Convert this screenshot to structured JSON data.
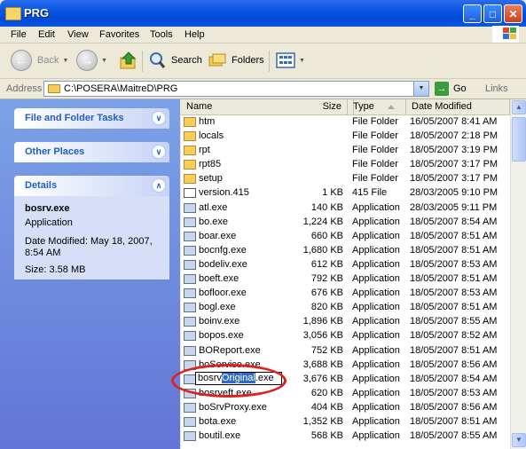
{
  "window": {
    "title": "PRG"
  },
  "title_buttons": {
    "minimize": "_",
    "maximize": "□",
    "close": "✕"
  },
  "menu": [
    "File",
    "Edit",
    "View",
    "Favorites",
    "Tools",
    "Help"
  ],
  "toolbar": {
    "back": "Back",
    "search": "Search",
    "folders": "Folders"
  },
  "address": {
    "label": "Address",
    "path": "C:\\POSERA\\MaitreD\\PRG",
    "go": "Go",
    "links": "Links"
  },
  "taskpane": {
    "panels": [
      {
        "title": "File and Folder Tasks",
        "state": "collapsed"
      },
      {
        "title": "Other Places",
        "state": "collapsed"
      },
      {
        "title": "Details",
        "state": "expanded"
      }
    ],
    "details": {
      "name": "bosrv.exe",
      "type": "Application",
      "modified_line1": "Date Modified: May 18, 2007,",
      "modified_line2": "8:54 AM",
      "size": "Size: 3.58 MB"
    }
  },
  "columns": {
    "name": "Name",
    "size": "Size",
    "type": "Type",
    "modified": "Date Modified"
  },
  "files": [
    {
      "name": "htm",
      "size": "",
      "type": "File Folder",
      "date": "16/05/2007 8:41 AM",
      "icon": "folder-icon"
    },
    {
      "name": "locals",
      "size": "",
      "type": "File Folder",
      "date": "18/05/2007 2:18 PM",
      "icon": "folder-icon"
    },
    {
      "name": "rpt",
      "size": "",
      "type": "File Folder",
      "date": "18/05/2007 3:19 PM",
      "icon": "folder-icon"
    },
    {
      "name": "rpt85",
      "size": "",
      "type": "File Folder",
      "date": "18/05/2007 3:17 PM",
      "icon": "folder-icon"
    },
    {
      "name": "setup",
      "size": "",
      "type": "File Folder",
      "date": "18/05/2007 3:17 PM",
      "icon": "folder-icon"
    },
    {
      "name": "version.415",
      "size": "1 KB",
      "type": "415 File",
      "date": "28/03/2005 9:10 PM",
      "icon": "file-icon"
    },
    {
      "name": "atl.exe",
      "size": "140 KB",
      "type": "Application",
      "date": "28/03/2005 9:11 PM",
      "icon": "exe-icon"
    },
    {
      "name": "bo.exe",
      "size": "1,224 KB",
      "type": "Application",
      "date": "18/05/2007 8:54 AM",
      "icon": "exe-icon"
    },
    {
      "name": "boar.exe",
      "size": "660 KB",
      "type": "Application",
      "date": "18/05/2007 8:51 AM",
      "icon": "exe-icon"
    },
    {
      "name": "bocnfg.exe",
      "size": "1,680 KB",
      "type": "Application",
      "date": "18/05/2007 8:51 AM",
      "icon": "exe-icon"
    },
    {
      "name": "bodeliv.exe",
      "size": "612 KB",
      "type": "Application",
      "date": "18/05/2007 8:53 AM",
      "icon": "exe-icon"
    },
    {
      "name": "boeft.exe",
      "size": "792 KB",
      "type": "Application",
      "date": "18/05/2007 8:51 AM",
      "icon": "exe-icon"
    },
    {
      "name": "bofloor.exe",
      "size": "676 KB",
      "type": "Application",
      "date": "18/05/2007 8:53 AM",
      "icon": "exe-icon"
    },
    {
      "name": "bogl.exe",
      "size": "820 KB",
      "type": "Application",
      "date": "18/05/2007 8:51 AM",
      "icon": "exe-icon"
    },
    {
      "name": "boinv.exe",
      "size": "1,896 KB",
      "type": "Application",
      "date": "18/05/2007 8:55 AM",
      "icon": "exe-icon"
    },
    {
      "name": "bopos.exe",
      "size": "3,056 KB",
      "type": "Application",
      "date": "18/05/2007 8:52 AM",
      "icon": "exe-icon"
    },
    {
      "name": "BOReport.exe",
      "size": "752 KB",
      "type": "Application",
      "date": "18/05/2007 8:51 AM",
      "icon": "exe-icon"
    },
    {
      "name": "boService.exe",
      "size": "3,688 KB",
      "type": "Application",
      "date": "18/05/2007 8:56 AM",
      "icon": "exe-icon"
    },
    {
      "name": "",
      "size": "3,676 KB",
      "type": "Application",
      "date": "18/05/2007 8:54 AM",
      "icon": "exe-icon",
      "rename": true
    },
    {
      "name": "bosrveft.exe",
      "size": "620 KB",
      "type": "Application",
      "date": "18/05/2007 8:53 AM",
      "icon": "exe-icon"
    },
    {
      "name": "boSrvProxy.exe",
      "size": "404 KB",
      "type": "Application",
      "date": "18/05/2007 8:56 AM",
      "icon": "exe-icon"
    },
    {
      "name": "bota.exe",
      "size": "1,352 KB",
      "type": "Application",
      "date": "18/05/2007 8:51 AM",
      "icon": "exe-icon"
    },
    {
      "name": "boutil.exe",
      "size": "568 KB",
      "type": "Application",
      "date": "18/05/2007 8:55 AM",
      "icon": "exe-icon"
    }
  ],
  "rename": {
    "before": "bosrv",
    "selected": "Original",
    "after": ".exe"
  },
  "colors": {
    "titlebar": "#0a55e0",
    "taskpane": "#6f8be0",
    "panel_title": "#215dc6",
    "highlight_oval": "#e0201b",
    "selection": "#316ac5"
  }
}
